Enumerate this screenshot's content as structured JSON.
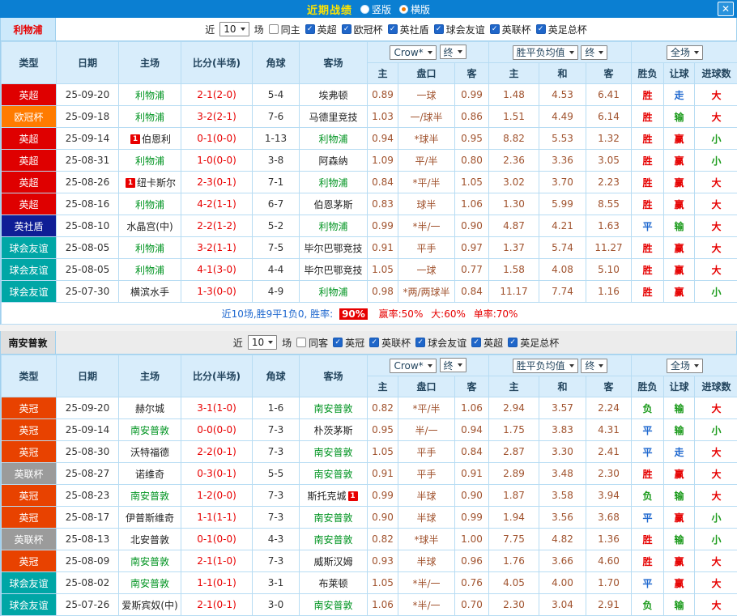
{
  "titlebar": {
    "title": "近期战绩",
    "radios": [
      {
        "label": "竖版",
        "selected": false
      },
      {
        "label": "横版",
        "selected": true
      }
    ],
    "close": "✕"
  },
  "table": {
    "main_cols": [
      "类型",
      "日期",
      "主场",
      "比分(半场)",
      "角球",
      "客场"
    ],
    "asia_cols": [
      "主",
      "盘口",
      "客"
    ],
    "europe_cols": [
      "主",
      "和",
      "客"
    ],
    "tail_cols": [
      "胜负",
      "让球",
      "进球数"
    ]
  },
  "colors": {
    "league": {
      "英超": "#df0000",
      "欧冠杯": "#ff7b00",
      "英社盾": "#0f1e96",
      "球会友谊": "#00a6a6",
      "英冠": "#e84200",
      "英联杯": "#9b9b9b"
    },
    "result": {
      "胜": "#e60000",
      "平": "#1f68cf",
      "负": "#1a9a1a"
    },
    "handicap": {
      "赢": "#e60000",
      "输": "#1a9a1a",
      "走": "#1f68cf"
    },
    "goals": {
      "大": "#e60000",
      "小": "#1a9a1a"
    },
    "focus_team": "#009421",
    "odds": "#a0522d",
    "score": "#e80000"
  },
  "sections": [
    {
      "team": "利物浦",
      "filters": {
        "near": "近",
        "count": "10",
        "unit": "场",
        "same": {
          "label": "同主",
          "checked": false
        },
        "leagues": [
          {
            "label": "英超",
            "checked": true
          },
          {
            "label": "欧冠杯",
            "checked": true
          },
          {
            "label": "英社盾",
            "checked": true
          },
          {
            "label": "球会友谊",
            "checked": true
          },
          {
            "label": "英联杯",
            "checked": true
          },
          {
            "label": "英足总杯",
            "checked": true
          }
        ]
      },
      "dropdowns": {
        "company": "Crow*",
        "company_state": "终",
        "europe": "胜平负均值",
        "europe_state": "终",
        "scope": "全场"
      },
      "rows": [
        {
          "league": "英超",
          "date": "25-09-20",
          "home": "利物浦",
          "home_focus": true,
          "score": "2-1(2-0)",
          "corners": "5-4",
          "away": "埃弗顿",
          "away_focus": false,
          "asia": [
            "0.89",
            "一球",
            "0.99"
          ],
          "europe": [
            "1.48",
            "4.53",
            "6.41"
          ],
          "result": "胜",
          "handicap": "走",
          "goals": "大"
        },
        {
          "league": "欧冠杯",
          "date": "25-09-18",
          "home": "利物浦",
          "home_focus": true,
          "score": "3-2(2-1)",
          "corners": "7-6",
          "away": "马德里竞技",
          "away_focus": false,
          "asia": [
            "1.03",
            "一/球半",
            "0.86"
          ],
          "europe": [
            "1.51",
            "4.49",
            "6.14"
          ],
          "result": "胜",
          "handicap": "输",
          "goals": "大"
        },
        {
          "league": "英超",
          "date": "25-09-14",
          "home": "伯恩利",
          "home_focus": false,
          "home_badge": "1",
          "score": "0-1(0-0)",
          "corners": "1-13",
          "away": "利物浦",
          "away_focus": true,
          "asia": [
            "0.94",
            "*球半",
            "0.95"
          ],
          "europe": [
            "8.82",
            "5.53",
            "1.32"
          ],
          "result": "胜",
          "handicap": "赢",
          "goals": "小"
        },
        {
          "league": "英超",
          "date": "25-08-31",
          "home": "利物浦",
          "home_focus": true,
          "score": "1-0(0-0)",
          "corners": "3-8",
          "away": "阿森纳",
          "away_focus": false,
          "asia": [
            "1.09",
            "平/半",
            "0.80"
          ],
          "europe": [
            "2.36",
            "3.36",
            "3.05"
          ],
          "result": "胜",
          "handicap": "赢",
          "goals": "小"
        },
        {
          "league": "英超",
          "date": "25-08-26",
          "home": "纽卡斯尔",
          "home_focus": false,
          "home_badge": "1",
          "score": "2-3(0-1)",
          "corners": "7-1",
          "away": "利物浦",
          "away_focus": true,
          "asia": [
            "0.84",
            "*平/半",
            "1.05"
          ],
          "europe": [
            "3.02",
            "3.70",
            "2.23"
          ],
          "result": "胜",
          "handicap": "赢",
          "goals": "大"
        },
        {
          "league": "英超",
          "date": "25-08-16",
          "home": "利物浦",
          "home_focus": true,
          "score": "4-2(1-1)",
          "corners": "6-7",
          "away": "伯恩茅斯",
          "away_focus": false,
          "asia": [
            "0.83",
            "球半",
            "1.06"
          ],
          "europe": [
            "1.30",
            "5.99",
            "8.55"
          ],
          "result": "胜",
          "handicap": "赢",
          "goals": "大"
        },
        {
          "league": "英社盾",
          "date": "25-08-10",
          "home": "水晶宫(中)",
          "home_focus": false,
          "score": "2-2(1-2)",
          "corners": "5-2",
          "away": "利物浦",
          "away_focus": true,
          "asia": [
            "0.99",
            "*半/一",
            "0.90"
          ],
          "europe": [
            "4.87",
            "4.21",
            "1.63"
          ],
          "result": "平",
          "handicap": "输",
          "goals": "大"
        },
        {
          "league": "球会友谊",
          "date": "25-08-05",
          "home": "利物浦",
          "home_focus": true,
          "score": "3-2(1-1)",
          "corners": "7-5",
          "away": "毕尔巴鄂竞技",
          "away_focus": false,
          "asia": [
            "0.91",
            "平手",
            "0.97"
          ],
          "europe": [
            "1.37",
            "5.74",
            "11.27"
          ],
          "result": "胜",
          "handicap": "赢",
          "goals": "大"
        },
        {
          "league": "球会友谊",
          "date": "25-08-05",
          "home": "利物浦",
          "home_focus": true,
          "score": "4-1(3-0)",
          "corners": "4-4",
          "away": "毕尔巴鄂竞技",
          "away_focus": false,
          "asia": [
            "1.05",
            "一球",
            "0.77"
          ],
          "europe": [
            "1.58",
            "4.08",
            "5.10"
          ],
          "result": "胜",
          "handicap": "赢",
          "goals": "大"
        },
        {
          "league": "球会友谊",
          "date": "25-07-30",
          "home": "横滨水手",
          "home_focus": false,
          "score": "1-3(0-0)",
          "corners": "4-9",
          "away": "利物浦",
          "away_focus": true,
          "asia": [
            "0.98",
            "*两/两球半",
            "0.84"
          ],
          "europe": [
            "11.17",
            "7.74",
            "1.16"
          ],
          "result": "胜",
          "handicap": "赢",
          "goals": "小"
        }
      ],
      "summary": {
        "lead": "近10场,胜9平1负0, 胜率:",
        "win_rate": "90%",
        "seg1": "赢率:50%",
        "seg2": "大:60%",
        "seg3": "单率:70%"
      }
    },
    {
      "team": "南安普敦",
      "filters": {
        "near": "近",
        "count": "10",
        "unit": "场",
        "same": {
          "label": "同客",
          "checked": false
        },
        "leagues": [
          {
            "label": "英冠",
            "checked": true
          },
          {
            "label": "英联杯",
            "checked": true
          },
          {
            "label": "球会友谊",
            "checked": true
          },
          {
            "label": "英超",
            "checked": true
          },
          {
            "label": "英足总杯",
            "checked": true
          }
        ]
      },
      "dropdowns": {
        "company": "Crow*",
        "company_state": "终",
        "europe": "胜平负均值",
        "europe_state": "终",
        "scope": "全场"
      },
      "rows": [
        {
          "league": "英冠",
          "date": "25-09-20",
          "home": "赫尔城",
          "home_focus": false,
          "score": "3-1(1-0)",
          "corners": "1-6",
          "away": "南安普敦",
          "away_focus": true,
          "asia": [
            "0.82",
            "*平/半",
            "1.06"
          ],
          "europe": [
            "2.94",
            "3.57",
            "2.24"
          ],
          "result": "负",
          "handicap": "输",
          "goals": "大"
        },
        {
          "league": "英冠",
          "date": "25-09-14",
          "home": "南安普敦",
          "home_focus": true,
          "score": "0-0(0-0)",
          "corners": "7-3",
          "away": "朴茨茅斯",
          "away_focus": false,
          "asia": [
            "0.95",
            "半/一",
            "0.94"
          ],
          "europe": [
            "1.75",
            "3.83",
            "4.31"
          ],
          "result": "平",
          "handicap": "输",
          "goals": "小"
        },
        {
          "league": "英冠",
          "date": "25-08-30",
          "home": "沃特福德",
          "home_focus": false,
          "score": "2-2(0-1)",
          "corners": "7-3",
          "away": "南安普敦",
          "away_focus": true,
          "asia": [
            "1.05",
            "平手",
            "0.84"
          ],
          "europe": [
            "2.87",
            "3.30",
            "2.41"
          ],
          "result": "平",
          "handicap": "走",
          "goals": "大"
        },
        {
          "league": "英联杯",
          "date": "25-08-27",
          "home": "诺维奇",
          "home_focus": false,
          "score": "0-3(0-1)",
          "corners": "5-5",
          "away": "南安普敦",
          "away_focus": true,
          "asia": [
            "0.91",
            "平手",
            "0.91"
          ],
          "europe": [
            "2.89",
            "3.48",
            "2.30"
          ],
          "result": "胜",
          "handicap": "赢",
          "goals": "大"
        },
        {
          "league": "英冠",
          "date": "25-08-23",
          "home": "南安普敦",
          "home_focus": true,
          "score": "1-2(0-0)",
          "corners": "7-3",
          "away": "斯托克城",
          "away_focus": false,
          "away_badge": "1",
          "away_badge_after": true,
          "asia": [
            "0.99",
            "半球",
            "0.90"
          ],
          "europe": [
            "1.87",
            "3.58",
            "3.94"
          ],
          "result": "负",
          "handicap": "输",
          "goals": "大"
        },
        {
          "league": "英冠",
          "date": "25-08-17",
          "home": "伊普斯维奇",
          "home_focus": false,
          "score": "1-1(1-1)",
          "corners": "7-3",
          "away": "南安普敦",
          "away_focus": true,
          "asia": [
            "0.90",
            "半球",
            "0.99"
          ],
          "europe": [
            "1.94",
            "3.56",
            "3.68"
          ],
          "result": "平",
          "handicap": "赢",
          "goals": "小"
        },
        {
          "league": "英联杯",
          "date": "25-08-13",
          "home": "北安普敦",
          "home_focus": false,
          "score": "0-1(0-0)",
          "corners": "4-3",
          "away": "南安普敦",
          "away_focus": true,
          "asia": [
            "0.82",
            "*球半",
            "1.00"
          ],
          "europe": [
            "7.75",
            "4.82",
            "1.36"
          ],
          "result": "胜",
          "handicap": "输",
          "goals": "小"
        },
        {
          "league": "英冠",
          "date": "25-08-09",
          "home": "南安普敦",
          "home_focus": true,
          "score": "2-1(1-0)",
          "corners": "7-3",
          "away": "威斯汉姆",
          "away_focus": false,
          "asia": [
            "0.93",
            "半球",
            "0.96"
          ],
          "europe": [
            "1.76",
            "3.66",
            "4.60"
          ],
          "result": "胜",
          "handicap": "赢",
          "goals": "大"
        },
        {
          "league": "球会友谊",
          "date": "25-08-02",
          "home": "南安普敦",
          "home_focus": true,
          "score": "1-1(0-1)",
          "corners": "3-1",
          "away": "布莱顿",
          "away_focus": false,
          "asia": [
            "1.05",
            "*半/一",
            "0.76"
          ],
          "europe": [
            "4.05",
            "4.00",
            "1.70"
          ],
          "result": "平",
          "handicap": "赢",
          "goals": "大"
        },
        {
          "league": "球会友谊",
          "date": "25-07-26",
          "home": "爱斯宾奴(中)",
          "home_focus": false,
          "score": "2-1(0-1)",
          "corners": "3-0",
          "away": "南安普敦",
          "away_focus": true,
          "asia": [
            "1.06",
            "*半/一",
            "0.70"
          ],
          "europe": [
            "2.30",
            "3.04",
            "2.91"
          ],
          "result": "负",
          "handicap": "输",
          "goals": "大"
        }
      ]
    }
  ]
}
